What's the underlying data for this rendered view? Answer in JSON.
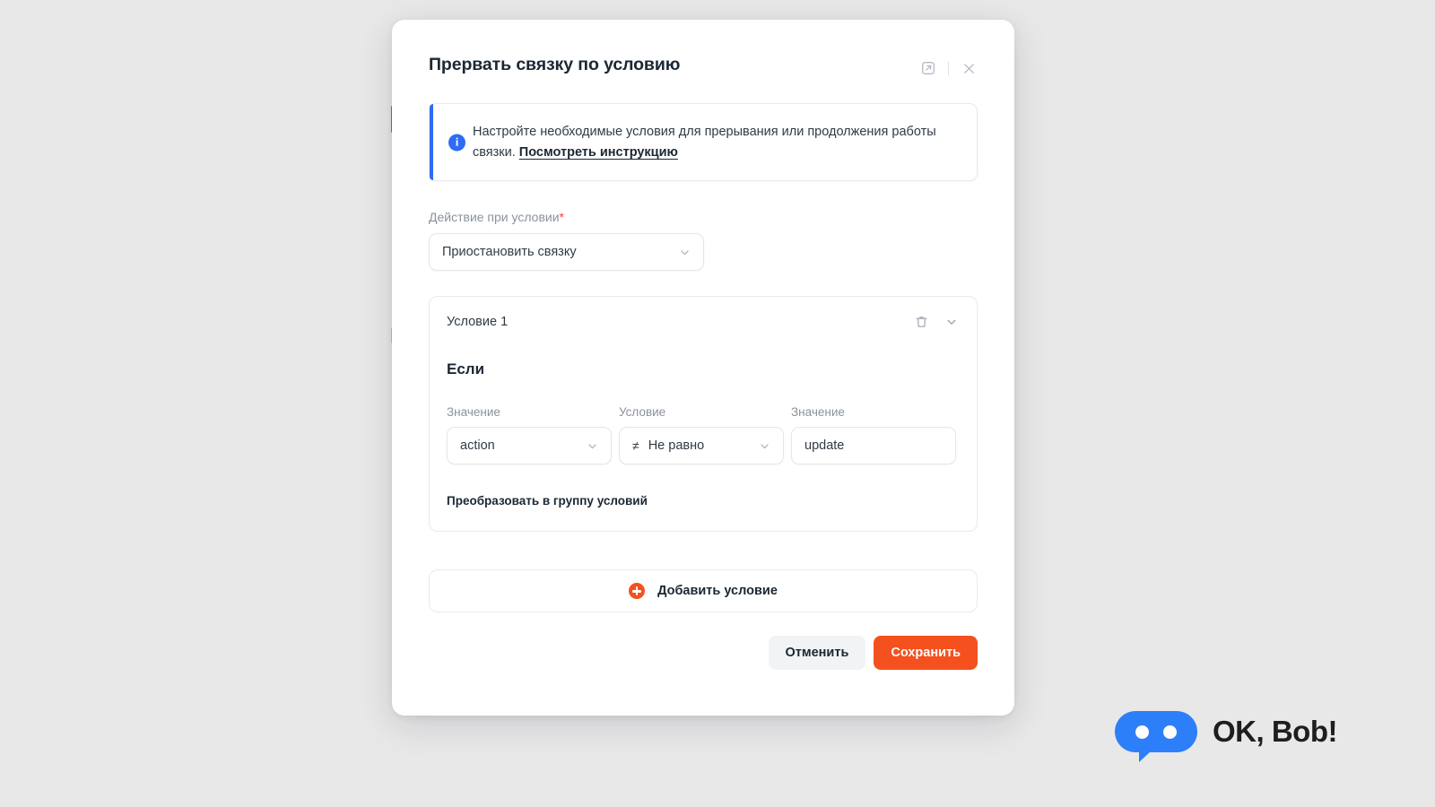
{
  "modal": {
    "title": "Прервать связку по условию",
    "header_icons": {
      "expand": "expand-window-icon",
      "close": "close-icon"
    },
    "info": {
      "icon": "info-icon",
      "text": "Настройте необходимые условия для прерывания или продолжения работы связки.",
      "link_label": "Посмотреть инструкцию"
    },
    "action_field": {
      "label": "Действие при условии",
      "required_marker": "*",
      "selected_value": "Приостановить связку",
      "chevron": "chevron-down-icon"
    },
    "condition_card": {
      "title": "Условие 1",
      "delete_icon": "trash-icon",
      "collapse_icon": "chevron-down-icon",
      "if_label": "Если",
      "fields": [
        {
          "label": "Значение",
          "value": "action",
          "type": "select",
          "operator_glyph": ""
        },
        {
          "label": "Условие",
          "value": "Не равно",
          "type": "select",
          "operator_glyph": "≠"
        },
        {
          "label": "Значение",
          "value": "update",
          "type": "input",
          "operator_glyph": ""
        }
      ],
      "convert_link": "Преобразовать в группу условий"
    },
    "add_condition": {
      "icon": "plus-circle-icon",
      "label": "Добавить условие"
    },
    "footer": {
      "cancel_label": "Отменить",
      "save_label": "Сохранить"
    }
  },
  "watermark": {
    "text": "OK, Bob!",
    "logo": "chat-bubble-logo"
  },
  "colors": {
    "accent_orange": "#F4511E",
    "accent_blue": "#2D6CF6",
    "logo_blue": "#2D7FF9",
    "required_red": "#F04438",
    "page_background": "#E8E8E8"
  }
}
